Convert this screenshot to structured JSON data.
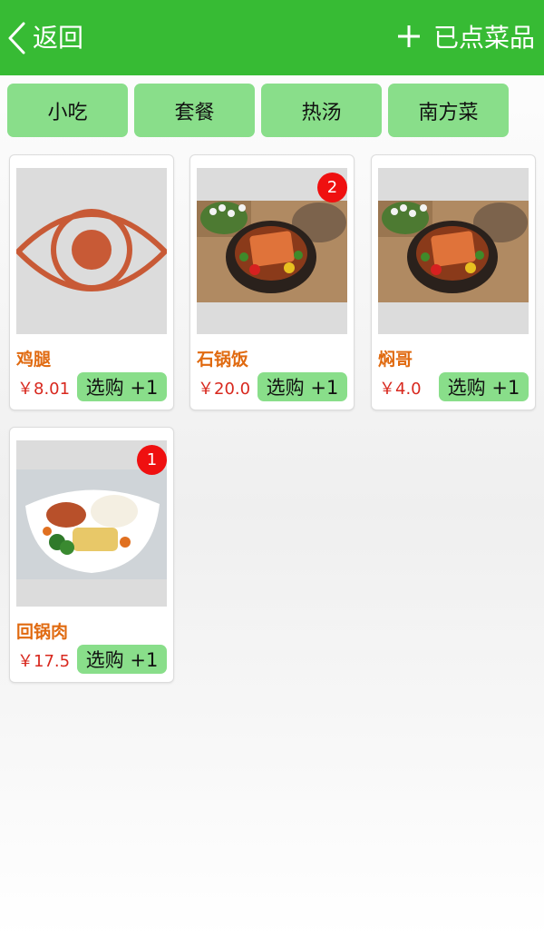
{
  "header": {
    "back_label": "返回",
    "cart_label": "已点菜品",
    "accent_color": "#37bb34"
  },
  "tabs": [
    {
      "label": "小吃"
    },
    {
      "label": "套餐"
    },
    {
      "label": "热汤"
    },
    {
      "label": "南方菜"
    }
  ],
  "dishes": [
    {
      "name": "鸡腿",
      "price": "￥8.01",
      "buy_label": "选购 +1",
      "badge": "",
      "image": "eye-placeholder-icon"
    },
    {
      "name": "石锅饭",
      "price": "￥20.0",
      "buy_label": "选购 +1",
      "badge": "2",
      "image": "stone-pot-dish-photo"
    },
    {
      "name": "焖哥",
      "price": "￥4.0",
      "buy_label": "选购 +1",
      "badge": "",
      "image": "stone-pot-dish-photo"
    },
    {
      "name": "回锅肉",
      "price": "￥17.5",
      "buy_label": "选购 +1",
      "badge": "1",
      "image": "chicken-rice-plate-photo"
    }
  ]
}
